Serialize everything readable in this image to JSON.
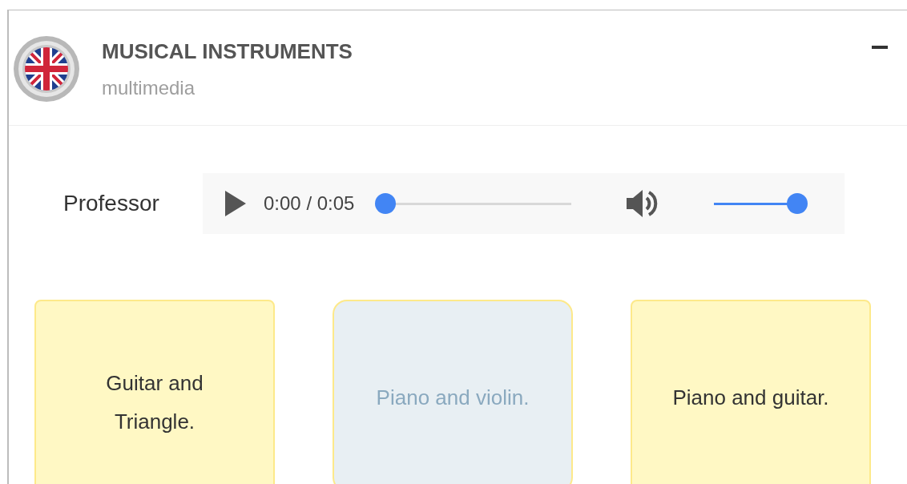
{
  "header": {
    "title": "MUSICAL INSTRUMENTS",
    "subtitle": "multimedia",
    "expanded": true
  },
  "audio": {
    "label": "Professor",
    "time": "0:00 / 0:05",
    "progress": {
      "level": 0
    },
    "volume": {
      "level": 1
    }
  },
  "options": [
    {
      "text": "Guitar and Triangle.",
      "selected": false
    },
    {
      "text": "Piano and violin.",
      "selected": true
    },
    {
      "text": "Piano and guitar.",
      "selected": false
    }
  ]
}
